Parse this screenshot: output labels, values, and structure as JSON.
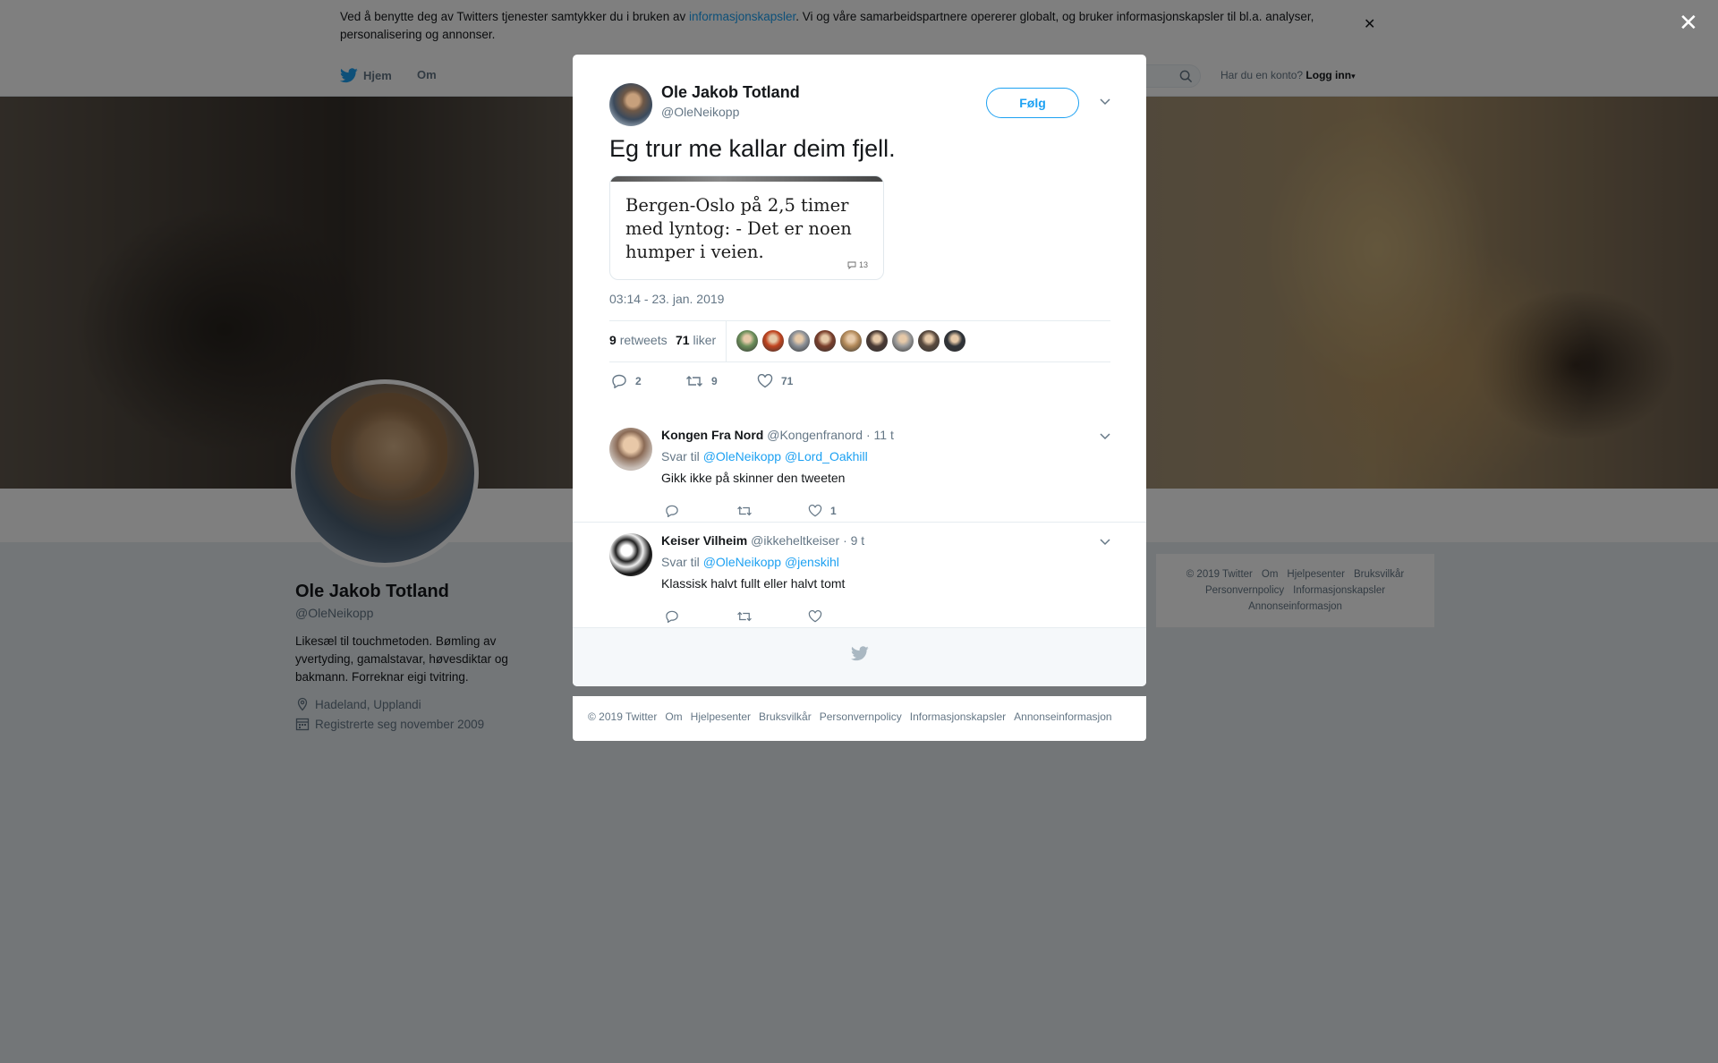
{
  "cookie_bar": {
    "text_before": "Ved å benytte deg av Twitters tjenester samtykker du i bruken av ",
    "link": "informasjonskapsler",
    "text_after": ". Vi og våre samarbeidspartnere opererer globalt, og bruker informasjonskapsler til bl.a. analyser, personalisering og annonser.",
    "close_icon": "close-icon"
  },
  "topnav": {
    "home_label": "Hjem",
    "about_label": "Om",
    "account_prompt": "Har du en konto?",
    "login_label": "Logg inn"
  },
  "profile": {
    "name": "Ole Jakob Totland",
    "handle": "@OleNeikopp",
    "bio": "Likesæl til touchmetoden. Bømling av yvertyding, gamalstavar, høvesdiktar og bakmann. Forreknar eigi tvitring.",
    "location": "Hadeland, Upplandi",
    "joined": "Registrerte seg november 2009"
  },
  "right_footer": {
    "links": [
      "© 2019 Twitter",
      "Om",
      "Hjelpesenter",
      "Bruksvilkår",
      "Personvernpolicy",
      "Informasjonskapsler",
      "Annonseinformasjon"
    ]
  },
  "tweet": {
    "author_name": "Ole Jakob Totland",
    "author_handle": "@OleNeikopp",
    "follow_label": "Følg",
    "text": "Eg trur me kallar deim fjell.",
    "card": {
      "headline": "Bergen-Oslo på 2,5 timer med lyntog: - Det er noen humper i veien.",
      "comment_count": "13"
    },
    "date": "03:14 - 23. jan. 2019",
    "retweets_count": "9",
    "retweets_label": "retweets",
    "likes_count": "71",
    "likes_label": "liker",
    "liker_face_colors": [
      "#6b8e5a",
      "#c0441f",
      "#8a8f96",
      "#7a3f2c",
      "#b38a5a",
      "#4a3a34",
      "#9a9a9a",
      "#5a4a3e",
      "#2f3338"
    ],
    "actions": {
      "reply_count": "2",
      "retweet_count": "9",
      "like_count": "71"
    }
  },
  "replies": [
    {
      "name": "Kongen Fra Nord",
      "handle": "@Kongenfranord",
      "time": "· 11 t",
      "reply_to_label": "Svar til",
      "mentions": [
        "@OleNeikopp",
        "@Lord_Oakhill"
      ],
      "text": "Gikk ikke på skinner den tweeten",
      "like_count": "1",
      "avatar_color": "#b89a80"
    },
    {
      "name": "Keiser Vilheim",
      "handle": "@ikkeheltkeiser",
      "time": "· 9 t",
      "reply_to_label": "Svar til",
      "mentions": [
        "@OleNeikopp",
        "@jenskihl"
      ],
      "text": "Klassisk halvt fullt eller halvt tomt",
      "like_count": "",
      "avatar_color": "#222222"
    }
  ],
  "modal_footer": {
    "links": [
      "© 2019 Twitter",
      "Om",
      "Hjelpesenter",
      "Bruksvilkår",
      "Personvernpolicy",
      "Informasjonskapsler",
      "Annonseinformasjon"
    ]
  },
  "colors": {
    "accent": "#1da1f2",
    "text": "#14171a",
    "muted": "#657786"
  }
}
